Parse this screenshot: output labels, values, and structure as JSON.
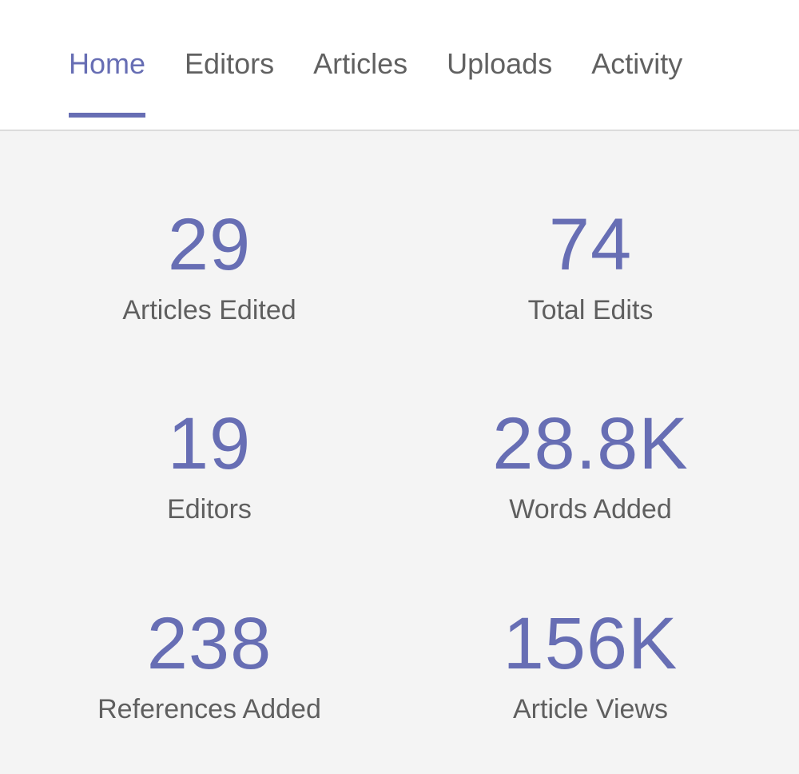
{
  "tabs": [
    {
      "label": "Home",
      "active": true
    },
    {
      "label": "Editors",
      "active": false
    },
    {
      "label": "Articles",
      "active": false
    },
    {
      "label": "Uploads",
      "active": false
    },
    {
      "label": "Activity",
      "active": false
    }
  ],
  "stats": [
    {
      "value": "29",
      "label": "Articles Edited"
    },
    {
      "value": "74",
      "label": "Total Edits"
    },
    {
      "value": "19",
      "label": "Editors"
    },
    {
      "value": "28.8K",
      "label": "Words Added"
    },
    {
      "value": "238",
      "label": "References Added"
    },
    {
      "value": "156K",
      "label": "Article Views"
    }
  ],
  "colors": {
    "accent": "#676eb4",
    "text_muted": "#616161",
    "background": "#f4f4f4",
    "header_background": "#ffffff"
  }
}
